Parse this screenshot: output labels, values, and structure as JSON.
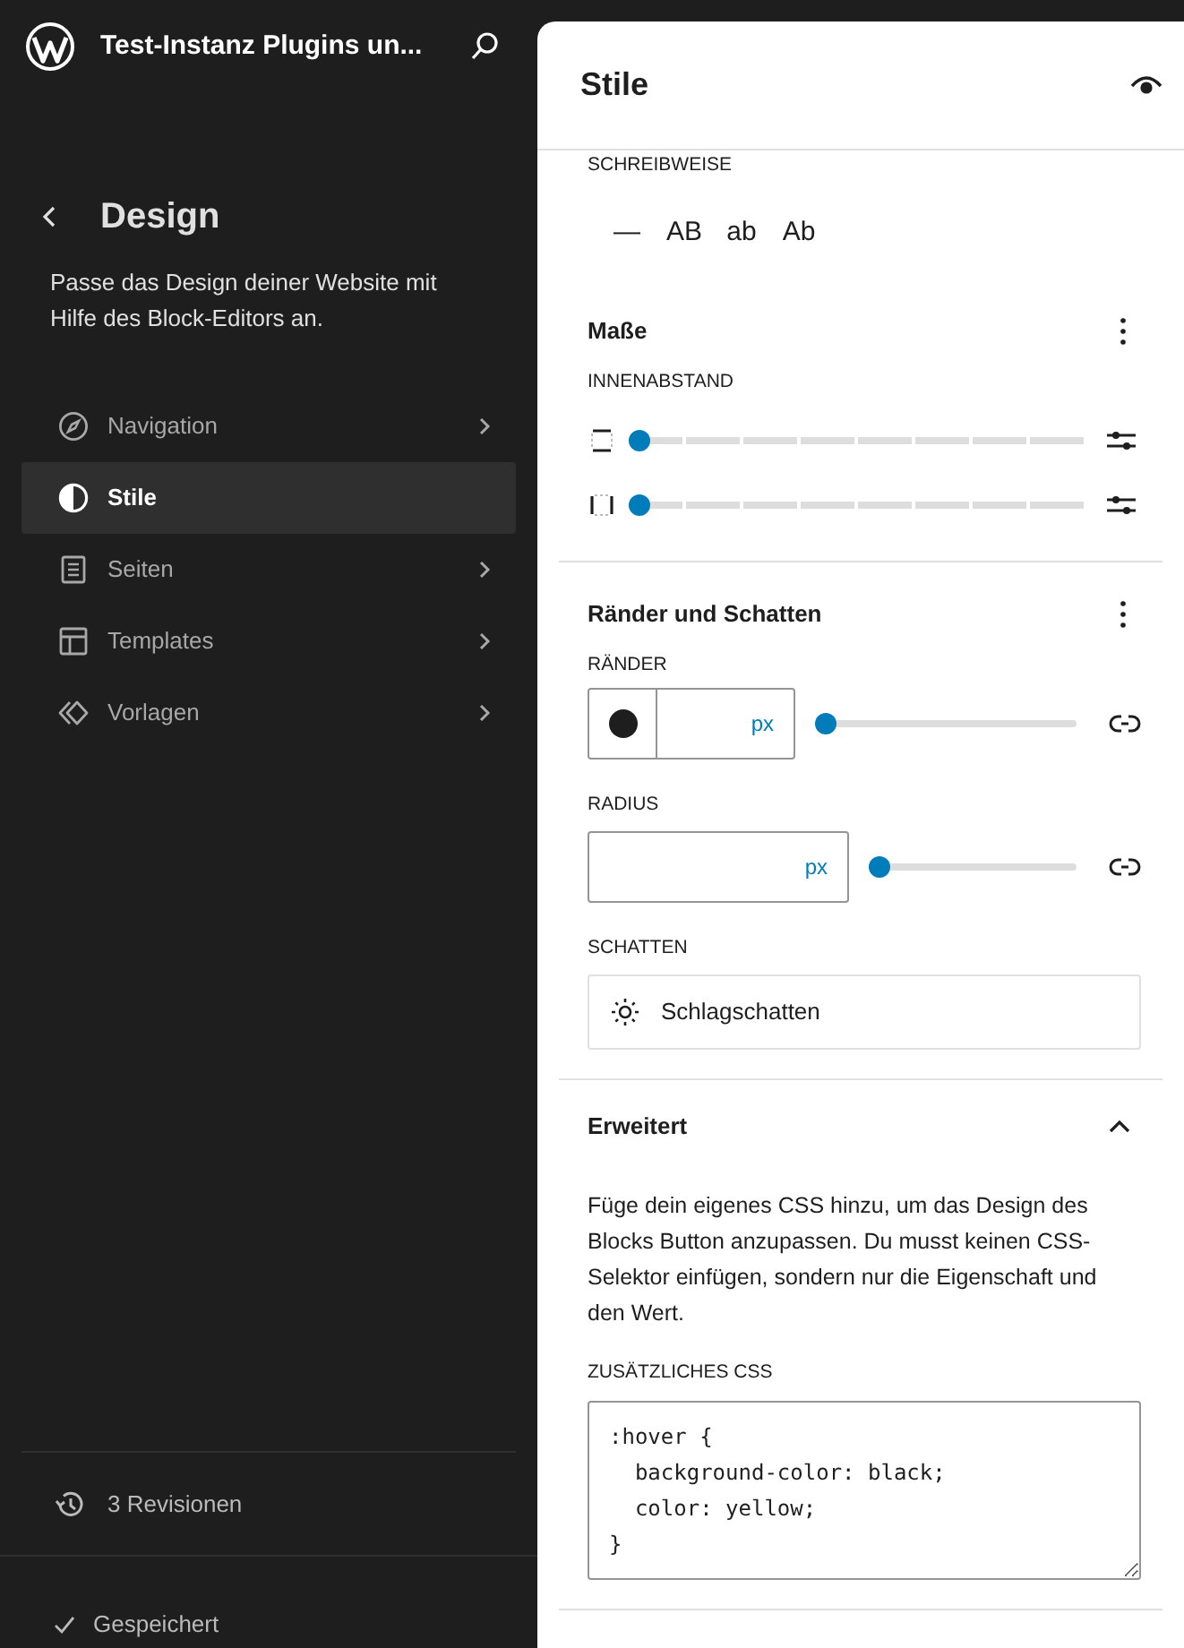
{
  "site": {
    "title": "Test-Instanz Plugins un..."
  },
  "sidebar": {
    "heading": "Design",
    "description": "Passe das Design deiner Website mit Hilfe des Block-Editors an.",
    "items": [
      {
        "label": "Navigation",
        "selected": false,
        "has_submenu": true
      },
      {
        "label": "Stile",
        "selected": true,
        "has_submenu": false
      },
      {
        "label": "Seiten",
        "selected": false,
        "has_submenu": true
      },
      {
        "label": "Templates",
        "selected": false,
        "has_submenu": true
      },
      {
        "label": "Vorlagen",
        "selected": false,
        "has_submenu": true
      }
    ],
    "revisions": "3 Revisionen",
    "save_status": "Gespeichert"
  },
  "styles_panel": {
    "title": "Stile",
    "letter_case": {
      "label": "SCHREIBWEISE",
      "options": [
        {
          "label": "—",
          "selected": false
        },
        {
          "label": "AB",
          "selected": false
        },
        {
          "label": "ab",
          "selected": false
        },
        {
          "label": "Ab",
          "selected": false
        }
      ]
    },
    "dimensions": {
      "title": "Maße",
      "padding_label": "INNENABSTAND",
      "sliders": [
        {
          "kind": "vertical",
          "level": 0
        },
        {
          "kind": "horizontal",
          "level": 0
        }
      ]
    },
    "borders": {
      "title": "Ränder und Schatten",
      "border": {
        "label": "RÄNDER",
        "unit": "px",
        "level": 0
      },
      "radius": {
        "label": "RADIUS",
        "unit": "px",
        "level": 0
      },
      "shadow": {
        "label": "SCHATTEN",
        "button": "Schlagschatten"
      }
    },
    "advanced": {
      "title": "Erweitert",
      "expanded": true,
      "description": "Füge dein eigenes CSS hinzu, um das Design des Blocks Button anzupassen. Du musst keinen CSS-Selektor einfügen, sondern nur die Eigenschaft und den Wert.",
      "css_label": "ZUSÄTZLICHES CSS",
      "css": ":hover {\n  background-color: black;\n  color: yellow;\n}"
    }
  }
}
